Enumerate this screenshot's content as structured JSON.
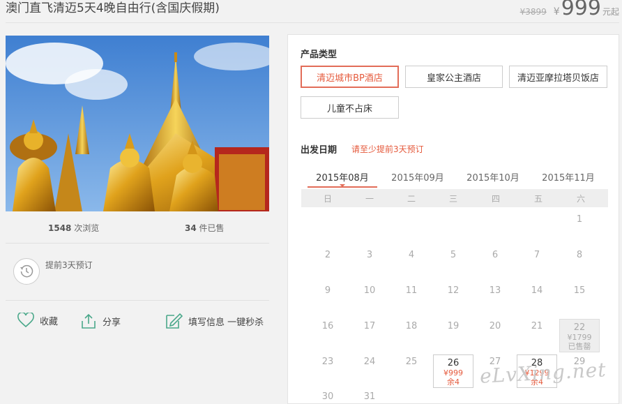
{
  "header": {
    "title": "澳门直飞清迈5天4晚自由行(含国庆假期)",
    "original_price": "¥3899",
    "currency": "¥",
    "price": "999",
    "price_suffix": "元起"
  },
  "stats": {
    "views_count": "1548",
    "views_label": "次浏览",
    "sold_count": "34",
    "sold_label": "件已售"
  },
  "advance": {
    "text": "提前3天预订"
  },
  "actions": {
    "favorite": "收藏",
    "share": "分享",
    "fill_info": "填写信息 一键秒杀"
  },
  "product_type": {
    "label": "产品类型",
    "options": [
      "清迈城市BP酒店",
      "皇家公主酒店",
      "清迈亚摩拉塔贝饭店",
      "儿童不占床"
    ],
    "selected_index": 0
  },
  "departure": {
    "label": "出发日期",
    "tip": "请至少提前3天预订",
    "months": [
      "2015年08月",
      "2015年09月",
      "2015年10月",
      "2015年11月"
    ],
    "active_month_index": 0,
    "weekdays": [
      "日",
      "一",
      "二",
      "三",
      "四",
      "五",
      "六"
    ],
    "days": [
      "1",
      "2",
      "3",
      "4",
      "5",
      "6",
      "7",
      "8",
      "9",
      "10",
      "11",
      "12",
      "13",
      "14",
      "15",
      "16",
      "17",
      "18",
      "19",
      "20",
      "21",
      "22",
      "23",
      "24",
      "25",
      "26",
      "27",
      "28",
      "29",
      "30",
      "31"
    ],
    "special": {
      "22": {
        "price": "¥1799",
        "status": "已售罄"
      },
      "26": {
        "price": "¥999",
        "status": "余4"
      },
      "28": {
        "price": "¥1299",
        "status": "余4"
      }
    }
  },
  "watermark": "eLvXing.net",
  "colors": {
    "accent": "#e55a3c",
    "green_icon": "#4aa88a"
  }
}
